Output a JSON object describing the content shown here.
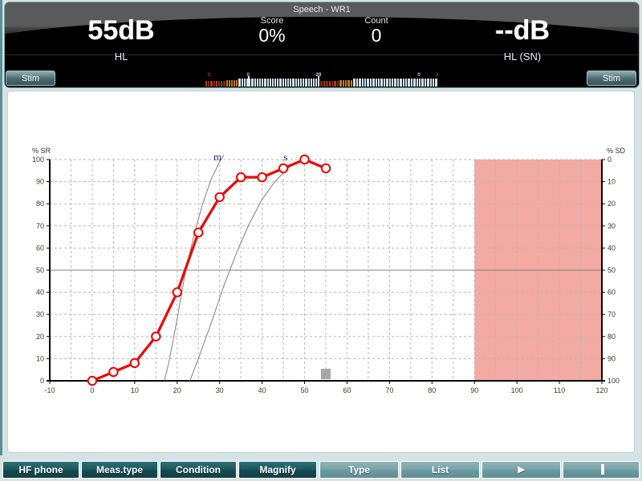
{
  "header": {
    "title": "Speech - WR1",
    "left_value": "55dB",
    "left_unit": "HL",
    "right_value": "--dB",
    "right_unit": "HL (SN)",
    "score_label": "Score",
    "score_value": "0%",
    "count_label": "Count",
    "count_value": "0",
    "stim_left_label": "Stim",
    "stim_right_label": "Stim",
    "vu_left_ticks": [
      "3",
      "0",
      "-20"
    ],
    "vu_right_ticks": [
      "0",
      "3"
    ]
  },
  "chart_data": {
    "type": "line",
    "title": "",
    "xlabel": "",
    "ylabel": "% SR",
    "y2label": "% SD",
    "xlim": [
      -10,
      120
    ],
    "ylim": [
      0,
      100
    ],
    "y2lim": [
      0,
      100
    ],
    "xticks": [
      -10,
      0,
      10,
      20,
      30,
      40,
      50,
      60,
      70,
      80,
      90,
      100,
      110,
      120
    ],
    "yticks": [
      0,
      10,
      20,
      30,
      40,
      50,
      60,
      70,
      80,
      90,
      100
    ],
    "y2ticks": [
      0,
      10,
      20,
      30,
      40,
      50,
      60,
      70,
      80,
      90,
      100
    ],
    "grid": true,
    "grid_minor_x_step": 5,
    "legend": "none",
    "series": [
      {
        "name": "WR1",
        "color": "#ee0000",
        "marker": "open-circle",
        "x": [
          0,
          5,
          10,
          15,
          20,
          25,
          30,
          35,
          40,
          45,
          50,
          55
        ],
        "values": [
          0,
          4,
          8,
          20,
          40,
          67,
          83,
          92,
          92,
          96,
          100,
          96
        ]
      },
      {
        "name": "m",
        "color": "#808080",
        "marker": "none",
        "x": [
          17,
          18,
          20,
          22,
          24,
          26,
          28,
          30,
          31
        ],
        "values": [
          0,
          8,
          28,
          50,
          66,
          80,
          91,
          99,
          102
        ]
      },
      {
        "name": "s",
        "color": "#808080",
        "marker": "none",
        "x": [
          23,
          25,
          28,
          31,
          34,
          37,
          40,
          43,
          46,
          48
        ],
        "values": [
          0,
          10,
          26,
          43,
          58,
          71,
          82,
          90,
          96,
          99
        ]
      }
    ],
    "annotations": [
      {
        "text": "m",
        "x": 29.5,
        "y": 101,
        "color": "#1c2f6e"
      },
      {
        "text": "s",
        "x": 45.5,
        "y": 101,
        "color": "#1c2f6e"
      }
    ],
    "shaded_region": {
      "x_from": 90,
      "x_to": 120,
      "y_from": 0,
      "y_to": 100,
      "color": "#f2aaa3"
    },
    "reference_line": {
      "y": 50,
      "color": "#808080"
    },
    "cursor_marker": {
      "x": 55,
      "y": 1.5,
      "color": "#a8a8a8"
    }
  },
  "toolbar": {
    "buttons": [
      {
        "label": "HF phone",
        "style": "dark",
        "name": "hf-phone-button"
      },
      {
        "label": "Meas.type",
        "style": "dark",
        "name": "meas-type-button"
      },
      {
        "label": "Condition",
        "style": "dark",
        "name": "condition-button"
      },
      {
        "label": "Magnify",
        "style": "dark",
        "name": "magnify-button"
      },
      {
        "label": "Type",
        "style": "light",
        "name": "type-button"
      },
      {
        "label": "List",
        "style": "light",
        "name": "list-button"
      },
      {
        "label": "▶",
        "style": "light",
        "name": "play-button"
      },
      {
        "label": "▐",
        "style": "light",
        "name": "pause-button"
      }
    ]
  }
}
